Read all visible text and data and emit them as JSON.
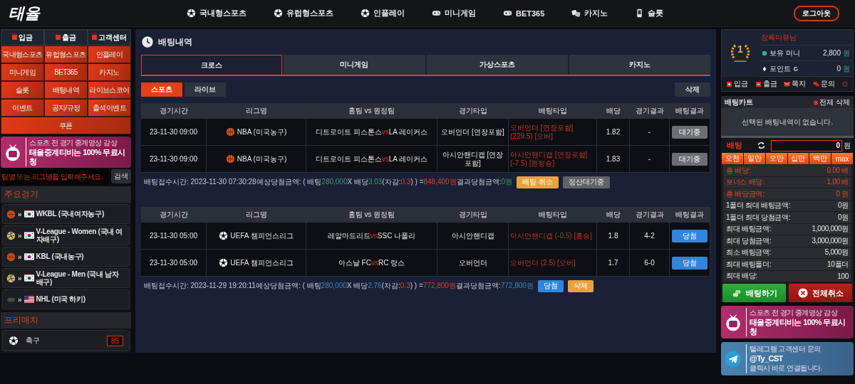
{
  "header": {
    "logo": "태율",
    "nav": [
      {
        "label": "국내형스포츠",
        "kind": "ball"
      },
      {
        "label": "유럽형스포츠",
        "kind": "ball"
      },
      {
        "label": "인플레이",
        "kind": "ball"
      },
      {
        "label": "미니게임",
        "kind": "gamepad"
      },
      {
        "label": "BET365",
        "kind": "gamepad"
      },
      {
        "label": "카지노",
        "kind": "chips"
      },
      {
        "label": "슬롯",
        "kind": "phone"
      }
    ],
    "logout": "로그아웃"
  },
  "left": {
    "top_buttons": [
      "입금",
      "출금",
      "고객센터"
    ],
    "menu": [
      "국내형스포츠",
      "유럽형스포츠",
      "인플레이",
      "미니게임",
      "BET365",
      "카지노",
      "슬롯",
      "배팅내역",
      "라이브스코어",
      "이벤트",
      "공지/규정",
      "출석이벤트",
      "쿠폰"
    ],
    "banner": {
      "line1": "스포츠 전 경기 중계영상 감상",
      "line2": "태율중계티비는 100% 무료시청"
    },
    "search": {
      "placeholder": "팀명 또는 리그명을 입력해주세요.",
      "button": "검색"
    },
    "major": {
      "title": "주요경기",
      "items": [
        {
          "sport": {
            "kind": "basketball"
          },
          "marker": "»",
          "flag": {
            "kind": "kr"
          },
          "label": "WKBL (국내여자농구)"
        },
        {
          "sport": {
            "kind": "volleyball"
          },
          "marker": "»",
          "flag": {
            "kind": "kr"
          },
          "label": "V-League - Women (국내 여자배구)"
        },
        {
          "sport": {
            "kind": "basketball"
          },
          "marker": "»",
          "flag": {
            "kind": "kr"
          },
          "label": "KBL (국내농구)"
        },
        {
          "sport": {
            "kind": "volleyball"
          },
          "marker": "»",
          "flag": {
            "kind": "kr"
          },
          "label": "V-League - Men (국내 남자 배구)"
        },
        {
          "sport": {
            "kind": "hockey"
          },
          "marker": "»",
          "flag": {
            "kind": "us"
          },
          "label": "NHL (미국 하키)"
        }
      ]
    },
    "prematch": {
      "title": "프리매치",
      "items": [
        {
          "sport": {
            "kind": "soccer"
          },
          "label": "축구",
          "count": "85"
        }
      ]
    }
  },
  "main": {
    "title": "배팅내역",
    "tabs": [
      {
        "label": "크로스",
        "selected": true
      },
      {
        "label": "미니게임",
        "selected": false
      },
      {
        "label": "가상스포츠",
        "selected": false
      },
      {
        "label": "카지노",
        "selected": false
      }
    ],
    "subtabs": [
      {
        "label": "스포츠",
        "selected": true
      },
      {
        "label": "라이브",
        "selected": false
      }
    ],
    "delete": "삭제",
    "groups": [
      {
        "columns": [
          "경기시간",
          "리그명",
          "홈팀 vs 원정팀",
          "경기타입",
          "배팅타입",
          "배당",
          "경기결과",
          "배팅결과"
        ],
        "rows": [
          {
            "time": "23-11-30 09:00",
            "sport": {
              "kind": "basketball"
            },
            "league": "NBA (미국농구)",
            "home": "디트로이트 피스톤스",
            "vs": "vs",
            "away": "LA 레이커스",
            "game_type": "오버언더 [연장포함]",
            "bet_type": "오버언더 [연장포함] (229.5) [오버]",
            "odds": "1.82",
            "result": "-",
            "status": {
              "text": "대기중",
              "kind": "pending"
            }
          },
          {
            "time": "23-11-30 09:00",
            "sport": {
              "kind": "basketball"
            },
            "league": "NBA (미국농구)",
            "home": "디트로이트 피스톤스",
            "vs": "vs",
            "away": "LA 레이커스",
            "game_type": "아시안핸디캡 [연장포함]",
            "bet_type": "아시안핸디캡 [연장포함] (-7.5) [원정승]",
            "odds": "1.83",
            "result": "-",
            "status": {
              "text": "대기중",
              "kind": "pending"
            }
          }
        ],
        "summary": [
          {
            "text": "배팅접수시간: 2023-11-30 07:30:28",
            "kind": "plain"
          },
          {
            "text": "예상당첨금액: ( 배팅",
            "kind": "plain"
          },
          {
            "text": "280,000",
            "kind": "positive"
          },
          {
            "text": "X 배당",
            "kind": "plain"
          },
          {
            "text": "3.03",
            "kind": "positive"
          },
          {
            "text": "(차감:",
            "kind": "plain"
          },
          {
            "text": "0.3",
            "kind": "negative"
          },
          {
            "text": ") ) =",
            "kind": "plain"
          },
          {
            "text": "848,400원",
            "kind": "negative"
          },
          {
            "text": "결과당첨금액:",
            "kind": "plain"
          },
          {
            "text": "0",
            "kind": "positive"
          },
          {
            "text": "원",
            "kind": "positive"
          }
        ],
        "buttons": [
          {
            "label": "배팅 취소",
            "kind": "cancel"
          },
          {
            "label": "정산대기중",
            "kind": "pending"
          }
        ]
      },
      {
        "columns": [
          "경기시간",
          "리그명",
          "홈팀 vs 원정팀",
          "경기타입",
          "배팅타입",
          "배당",
          "경기결과",
          "배팅결과"
        ],
        "rows": [
          {
            "time": "23-11-30 05:00",
            "sport": {
              "kind": "soccer"
            },
            "league": "UEFA 챔피언스리그",
            "home": "레알마드리드",
            "vs": "vs",
            "away": "SSC 나폴리",
            "game_type": "아시안핸디캡",
            "bet_type": "아시안핸디캡 (-0.5) [홈승]",
            "odds": "1.8",
            "result": "4-2",
            "status": {
              "text": "당첨",
              "kind": "win"
            }
          },
          {
            "time": "23-11-30 05:00",
            "sport": {
              "kind": "soccer"
            },
            "league": "UEFA 챔피언스리그",
            "home": "아스날 FC",
            "vs": "vs",
            "away": "RC 랑스",
            "game_type": "오버언더",
            "bet_type": "오버언더 (2.5) [오버]",
            "odds": "1.7",
            "result": "6-0",
            "status": {
              "text": "당첨",
              "kind": "win"
            }
          }
        ],
        "summary": [
          {
            "text": "배팅접수시간: 2023-11-29 19:20:11",
            "kind": "plain"
          },
          {
            "text": "예상당첨금액: ( 배팅",
            "kind": "plain"
          },
          {
            "text": "280,000",
            "kind": "settled"
          },
          {
            "text": "X 배당",
            "kind": "plain"
          },
          {
            "text": "2.76",
            "kind": "settled"
          },
          {
            "text": "(차감:",
            "kind": "plain"
          },
          {
            "text": "0.3",
            "kind": "negative"
          },
          {
            "text": ") ) =",
            "kind": "plain"
          },
          {
            "text": "772,800원",
            "kind": "negative"
          },
          {
            "text": "결과당첨금액:",
            "kind": "plain"
          },
          {
            "text": "772,800",
            "kind": "settled"
          },
          {
            "text": "원",
            "kind": "settled"
          }
        ],
        "buttons": [
          {
            "label": "당첨",
            "kind": "win"
          },
          {
            "label": "삭제",
            "kind": "delete"
          }
        ]
      }
    ]
  },
  "right": {
    "user": {
      "rank": "1",
      "name": "장록미유님",
      "money_label": "보유 머니",
      "money": "2,800",
      "money_unit": "원",
      "point_label": "포인트",
      "points": "0",
      "point_unit": "원"
    },
    "actions": [
      {
        "label": "입금",
        "kind": "deposit"
      },
      {
        "label": "출금",
        "kind": "withdraw"
      },
      {
        "label": "쪽지",
        "kind": "mail"
      },
      {
        "label": "문의",
        "kind": "chat"
      }
    ],
    "cart": {
      "title": "배팅카트",
      "clear": "전체 삭제",
      "empty": "선택된 배팅내역이 없습니다.",
      "stake_label": "배팅",
      "stake": "0",
      "stake_unit": "원",
      "chips": [
        "오천",
        "일만",
        "오만",
        "십만",
        "백만",
        "max"
      ],
      "stats": [
        {
          "label": "총 배당:",
          "value": "0.00 배",
          "kind": "accent"
        },
        {
          "label": "보너스 배당:",
          "value": "1.00 배",
          "kind": "accent"
        },
        {
          "label": "총 배당금액:",
          "value": "0 원",
          "kind": "accent"
        },
        {
          "label": "1폴더 최대 배팅금액:",
          "value": "0원",
          "kind": "plain"
        },
        {
          "label": "1폴더 최대 당첨금액:",
          "value": "0원",
          "kind": "plain"
        },
        {
          "label": "최대 배팅금액:",
          "value": "1,000,000원",
          "kind": "plain"
        },
        {
          "label": "최대 당첨금액:",
          "value": "3,000,000원",
          "kind": "plain"
        },
        {
          "label": "최소 배팅금액:",
          "value": "5,000원",
          "kind": "plain"
        },
        {
          "label": "최대 배팅폴더:",
          "value": "10폴더",
          "kind": "plain"
        },
        {
          "label": "최대 배당:",
          "value": "100",
          "kind": "plain"
        }
      ],
      "bet_button": "배팅하기",
      "cancel_button": "전체취소"
    },
    "banner": {
      "line1": "스포츠 전 경기 중계영상 감상",
      "line2": "태율중계티비는 100% 무료시청"
    },
    "telegram": {
      "line1": "텔레그램 고객센터 문의",
      "handle": "@Ty_CST",
      "line2": "클릭시 바로 연결됩니다."
    }
  }
}
